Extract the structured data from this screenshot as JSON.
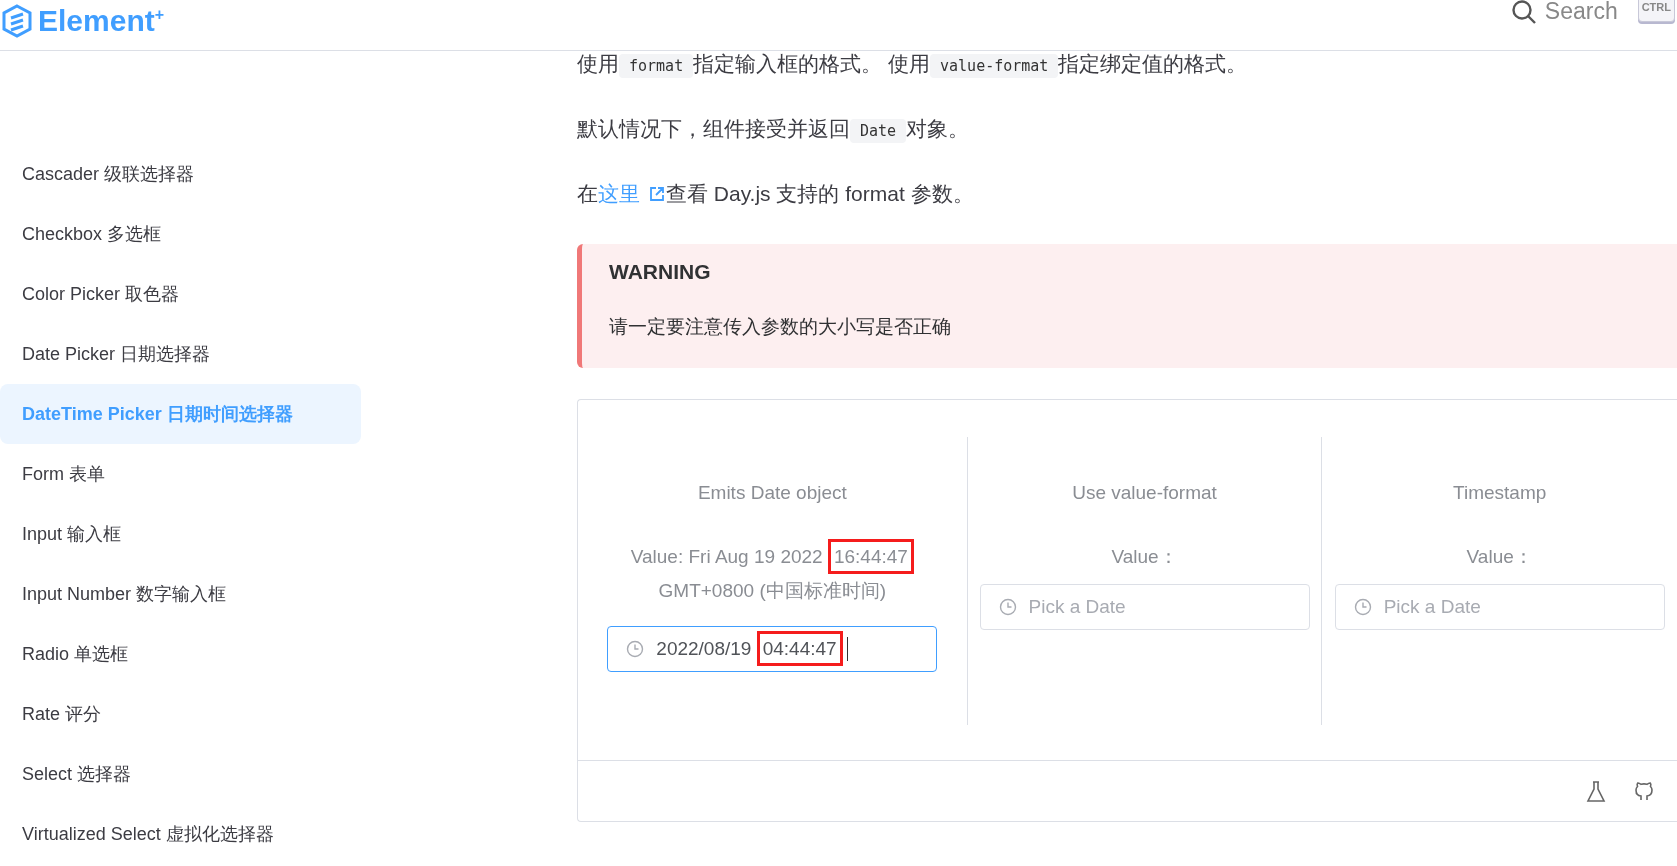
{
  "header": {
    "logo": "Element",
    "logo_mark": "+",
    "search": {
      "placeholder": "Search"
    },
    "shortcut": "CTRL"
  },
  "sidebar": {
    "items": [
      {
        "label": "Cascader 级联选择器",
        "selected": false
      },
      {
        "label": "Checkbox 多选框",
        "selected": false
      },
      {
        "label": "Color Picker 取色器",
        "selected": false
      },
      {
        "label": "Date Picker 日期选择器",
        "selected": false
      },
      {
        "label": "DateTime Picker 日期时间选择器",
        "selected": true
      },
      {
        "label": "Form 表单",
        "selected": false
      },
      {
        "label": "Input 输入框",
        "selected": false
      },
      {
        "label": "Input Number 数字输入框",
        "selected": false
      },
      {
        "label": "Radio 单选框",
        "selected": false
      },
      {
        "label": "Rate 评分",
        "selected": false
      },
      {
        "label": "Select 选择器",
        "selected": false
      },
      {
        "label": "Virtualized Select 虚拟化选择器",
        "selected": false
      }
    ]
  },
  "paragraphs": [
    [
      {
        "kind": "text",
        "text": "使用"
      },
      {
        "kind": "code",
        "text": "format"
      },
      {
        "kind": "text",
        "text": "指定输入框的格式。 使用"
      },
      {
        "kind": "code",
        "text": "value-format"
      },
      {
        "kind": "text",
        "text": "指定绑定值的格式。"
      }
    ],
    [
      {
        "kind": "text",
        "text": "默认情况下，组件接受并返回"
      },
      {
        "kind": "code",
        "text": "Date"
      },
      {
        "kind": "text",
        "text": "对象。"
      }
    ],
    [
      {
        "kind": "text",
        "text": "在"
      },
      {
        "kind": "link",
        "text": "这里"
      },
      {
        "kind": "text",
        "text": "查看 Day.js 支持的 format 参数。"
      }
    ]
  ],
  "warning": {
    "title": "WARNING",
    "text": "请一定要注意传入参数的大小写是否正确"
  },
  "demo": {
    "columns": [
      {
        "title": "Emits Date object",
        "value": [
          {
            "text": "Value: Fri Aug 19 2022",
            "highlighted": false
          },
          {
            "text": "16:44:47",
            "highlighted": true
          },
          {
            "text": "GMT+0800 (中国标准时间)",
            "highlighted": false
          }
        ],
        "input": {
          "value": [
            {
              "text": "2022/08/19",
              "highlighted": false
            },
            {
              "text": "04:44:47",
              "highlighted": true
            }
          ],
          "focused": true
        }
      },
      {
        "title": "Use value-format",
        "value": [
          {
            "text": "Value：",
            "highlighted": false
          }
        ],
        "input": {
          "placeholder": "Pick a Date",
          "focused": false
        }
      },
      {
        "title": "Timestamp",
        "value": [
          {
            "text": "Value：",
            "highlighted": false
          }
        ],
        "input": {
          "placeholder": "Pick a Date",
          "focused": false
        }
      }
    ]
  }
}
